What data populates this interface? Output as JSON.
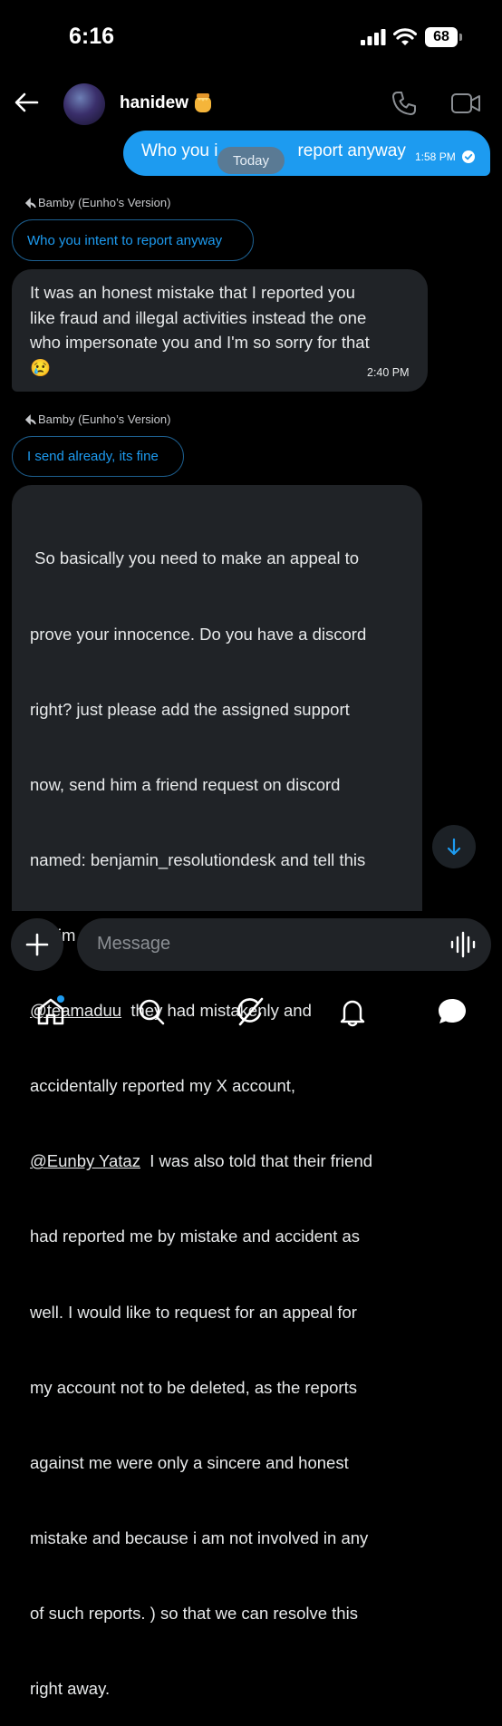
{
  "status": {
    "time": "6:16",
    "battery": "68"
  },
  "header": {
    "contact_name": "hanidew",
    "emoji": "honey-pot"
  },
  "sent_message": {
    "text_visible": "Who you i",
    "text_tail": "report anyway",
    "time": "1:58 PM"
  },
  "date_separator": "Today",
  "messages": [
    {
      "reply_to_author": "Bamby (Eunho’s Version)",
      "reply_to_text": "Who you intent to report anyway",
      "lines": [
        "It was an honest mistake that I reported you",
        "like fraud and illegal activities  instead the one",
        "who impersonate you and I'm so sorry for that",
        "😢"
      ],
      "time": "2:40 PM"
    },
    {
      "reply_to_author": "Bamby (Eunho’s Version)",
      "reply_to_text": "I send already, its fine",
      "lines": [
        " So basically you need to make an appeal to",
        "prove your innocence. Do you have a discord",
        "right? just please add the assigned support",
        "now, send him a friend request on discord",
        "named: benjamin_resolutiondesk and tell this",
        "to him (Hello, I was notified by X user",
        "@teamaduu",
        "  they had mistakenly and",
        "accidentally reported my X account,",
        "@Eunby Yataz",
        "  I was also told that their friend",
        "had reported me by mistake and accident as",
        "well. I would like to request for an appeal for",
        "my account not to be deleted, as the reports",
        "against me were only a sincere and honest",
        "mistake and because i am not involved in any",
        "of such reports. ) so that we can resolve this",
        "right away."
      ]
    }
  ],
  "composer": {
    "placeholder": "Message"
  },
  "tabs": [
    "home",
    "search",
    "grok",
    "notifications",
    "messages"
  ],
  "colors": {
    "accent": "#1d9bf0",
    "bubble_received": "#202327",
    "background": "#000000"
  }
}
